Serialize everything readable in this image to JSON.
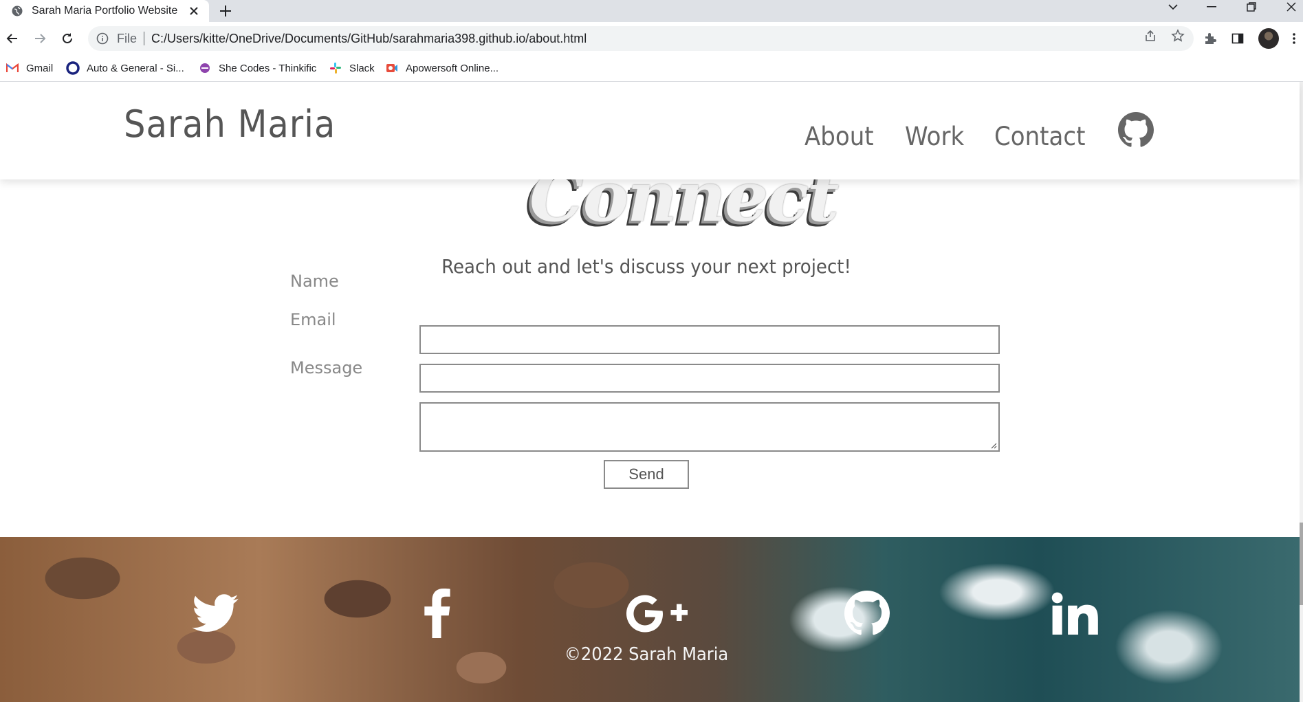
{
  "browser": {
    "tab_title": "Sarah Maria Portfolio Website",
    "url_scheme": "File",
    "url": "C:/Users/kitte/OneDrive/Documents/GitHub/sarahmaria398.github.io/about.html",
    "bookmarks": [
      {
        "label": "Gmail",
        "icon": "gmail-icon"
      },
      {
        "label": "Auto & General - Si...",
        "icon": "circle-icon"
      },
      {
        "label": "She Codes - Thinkific",
        "icon": "shecodes-icon"
      },
      {
        "label": "Slack",
        "icon": "slack-icon"
      },
      {
        "label": "Apowersoft Online...",
        "icon": "apowersoft-icon"
      }
    ]
  },
  "site": {
    "brand": "Sarah Maria",
    "nav": [
      {
        "label": "About"
      },
      {
        "label": "Work"
      },
      {
        "label": "Contact"
      }
    ],
    "nav_icon": "github-icon"
  },
  "contact": {
    "title": "Connect",
    "subtitle": "Reach out and let's discuss your next project!",
    "fields": {
      "name_label": "Name",
      "email_label": "Email",
      "message_label": "Message",
      "name_value": "",
      "email_value": "",
      "message_value": ""
    },
    "send_label": "Send"
  },
  "footer": {
    "social_icons": [
      "twitter-icon",
      "facebook-icon",
      "google-plus-icon",
      "github-icon",
      "linkedin-icon"
    ],
    "copyright": "©2022 Sarah Maria"
  }
}
